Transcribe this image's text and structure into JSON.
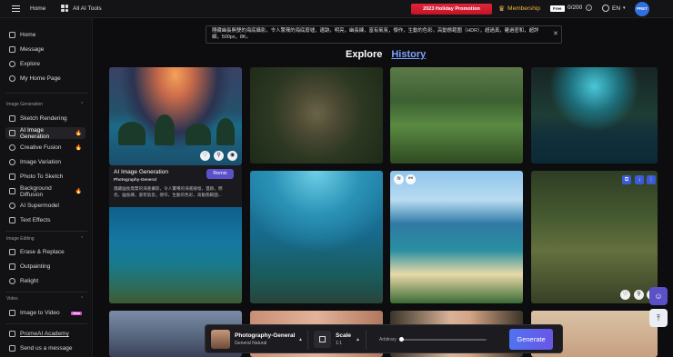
{
  "topbar": {
    "home_label": "Home",
    "tools_label": "All AI Tools",
    "promo_label": "2023 Holiday Promotion",
    "membership_label": "Membership",
    "free_badge": "Free",
    "credits": "0/200",
    "language": "EN",
    "avatar_initials": "PRET"
  },
  "sidebar": {
    "top_items": [
      "Home",
      "Message",
      "Explore",
      "My Home Page"
    ],
    "section_image_generation": "Image Generation",
    "image_generation_items": [
      "Sketch Rendering",
      "AI Image Generation",
      "Creative Fusion",
      "Image Variation",
      "Photo To Sketch",
      "Background Diffusion",
      "AI Supermodel",
      "Text Effects"
    ],
    "section_image_editing": "Image Editing",
    "image_editing_items": [
      "Erase & Replace",
      "Outpainting",
      "Relight"
    ],
    "section_video": "Video",
    "video_items": [
      "Image to Video"
    ],
    "video_new_badge": "New",
    "bottom_items": [
      "PromeAI Academy",
      "Send us a message"
    ]
  },
  "prompt": {
    "text": "隱藏幽長無雙的海底攝影，令人驚嘆的海底廢墟，遺跡，明亮，幽長練，富有氣氛，傑作，生動的色彩，高動態範圍（HDR），超過真，雞過密和，超詳細，500px，8K。"
  },
  "tabs": {
    "explore": "Explore",
    "history": "History"
  },
  "featured_card": {
    "title": "AI Image Generation",
    "style": "Photography-General",
    "description": "隱藏幽長無雙的海底攝影，令人驚嘆的海底廢墟，遺跡，明亮，幽長練，富有氣氛，傑作，生動的色彩，高動態範圍...",
    "remix_label": "Remix"
  },
  "generate_bar": {
    "style_name": "Photography-General",
    "style_sub": "General Natural",
    "scale_label": "Scale",
    "scale_value": "1:1",
    "arbitrary_label": "Arbitrary",
    "arbitrary_value": 0.02,
    "generate_label": "Generate"
  },
  "colors": {
    "accent": "#5b50c9",
    "promo": "#e2243b",
    "membership": "#f2b640",
    "history_link": "#7aa2ff"
  }
}
